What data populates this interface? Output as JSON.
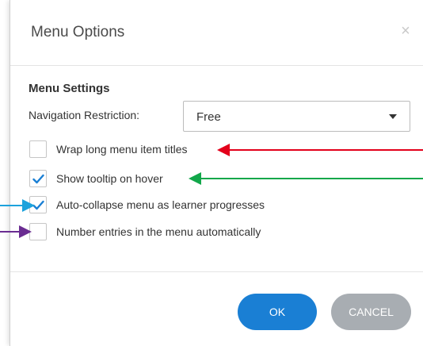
{
  "dialog": {
    "title": "Menu Options",
    "close_glyph": "×"
  },
  "settings": {
    "section_title": "Menu Settings",
    "navigation_label": "Navigation Restriction:",
    "navigation_value": "Free"
  },
  "options": [
    {
      "label": "Wrap long menu item titles",
      "checked": false
    },
    {
      "label": "Show tooltip on hover",
      "checked": true
    },
    {
      "label": "Auto-collapse menu as learner progresses",
      "checked": true
    },
    {
      "label": "Number entries in the menu automatically",
      "checked": false
    }
  ],
  "buttons": {
    "ok": "OK",
    "cancel": "CANCEL"
  },
  "colors": {
    "accent": "#1a7fd4",
    "cancel": "#a8adb2",
    "checkmark": "#1a7fd4",
    "arrow_red": "#e3001b",
    "arrow_green": "#12a74a",
    "arrow_blue": "#1ca2dc",
    "arrow_purple": "#6a2c91"
  },
  "icons": {
    "close": "close-icon",
    "dropdown": "chevron-down-icon",
    "check": "check-icon"
  }
}
